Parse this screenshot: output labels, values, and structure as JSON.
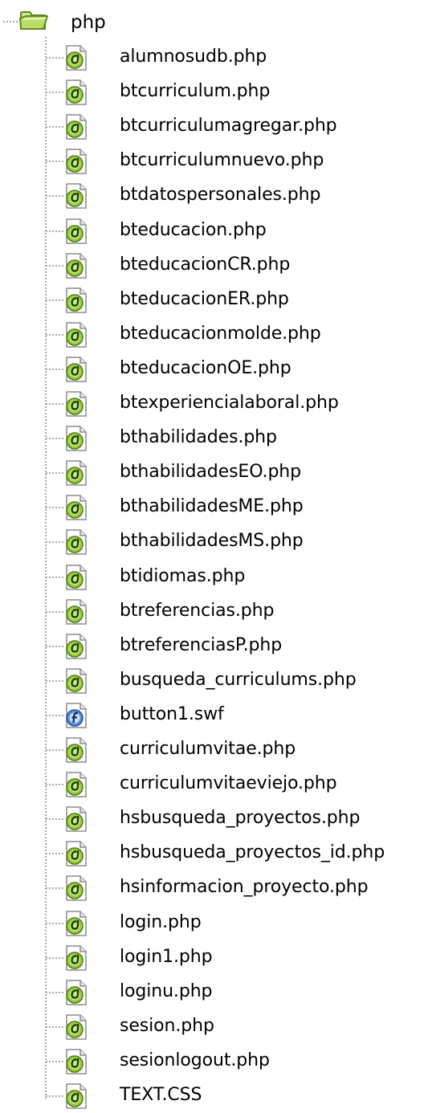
{
  "root": {
    "label": "php",
    "icon": "open-folder-icon"
  },
  "files": [
    {
      "label": "alumnosudb.php",
      "icon": "php-file-icon"
    },
    {
      "label": "btcurriculum.php",
      "icon": "php-file-icon"
    },
    {
      "label": "btcurriculumagregar.php",
      "icon": "php-file-icon"
    },
    {
      "label": "btcurriculumnuevo.php",
      "icon": "php-file-icon"
    },
    {
      "label": "btdatospersonales.php",
      "icon": "php-file-icon"
    },
    {
      "label": "bteducacion.php",
      "icon": "php-file-icon"
    },
    {
      "label": "bteducacionCR.php",
      "icon": "php-file-icon"
    },
    {
      "label": "bteducacionER.php",
      "icon": "php-file-icon"
    },
    {
      "label": "bteducacionmolde.php",
      "icon": "php-file-icon"
    },
    {
      "label": "bteducacionOE.php",
      "icon": "php-file-icon"
    },
    {
      "label": "btexperiencialaboral.php",
      "icon": "php-file-icon"
    },
    {
      "label": "bthabilidades.php",
      "icon": "php-file-icon"
    },
    {
      "label": "bthabilidadesEO.php",
      "icon": "php-file-icon"
    },
    {
      "label": "bthabilidadesME.php",
      "icon": "php-file-icon"
    },
    {
      "label": "bthabilidadesMS.php",
      "icon": "php-file-icon"
    },
    {
      "label": "btidiomas.php",
      "icon": "php-file-icon"
    },
    {
      "label": "btreferencias.php",
      "icon": "php-file-icon"
    },
    {
      "label": "btreferenciasP.php",
      "icon": "php-file-icon"
    },
    {
      "label": "busqueda_curriculums.php",
      "icon": "php-file-icon"
    },
    {
      "label": "button1.swf",
      "icon": "swf-file-icon"
    },
    {
      "label": "curriculumvitae.php",
      "icon": "php-file-icon"
    },
    {
      "label": "curriculumvitaeviejo.php",
      "icon": "php-file-icon"
    },
    {
      "label": "hsbusqueda_proyectos.php",
      "icon": "php-file-icon"
    },
    {
      "label": "hsbusqueda_proyectos_id.php",
      "icon": "php-file-icon"
    },
    {
      "label": "hsinformacion_proyecto.php",
      "icon": "php-file-icon"
    },
    {
      "label": "login.php",
      "icon": "php-file-icon"
    },
    {
      "label": "login1.php",
      "icon": "php-file-icon"
    },
    {
      "label": "loginu.php",
      "icon": "php-file-icon"
    },
    {
      "label": "sesion.php",
      "icon": "php-file-icon"
    },
    {
      "label": "sesionlogout.php",
      "icon": "php-file-icon"
    },
    {
      "label": "TEXT.CSS",
      "icon": "css-file-icon"
    }
  ],
  "colors": {
    "tree_line": "#a9a9a9",
    "folder_fill": "#b8de67",
    "folder_stroke": "#5e8a1a",
    "php_icon_green": "#9ccc3c",
    "swf_icon_blue": "#3b6fb6"
  }
}
